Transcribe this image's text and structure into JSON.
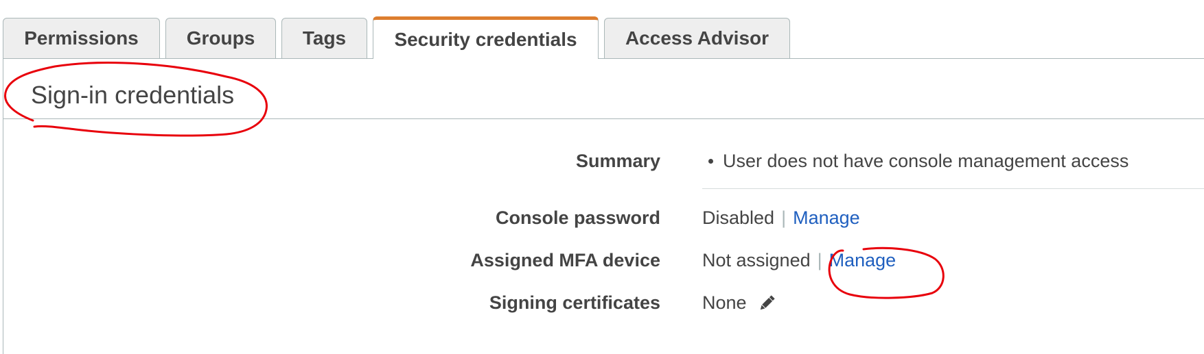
{
  "tabs": [
    {
      "label": "Permissions",
      "active": false
    },
    {
      "label": "Groups",
      "active": false
    },
    {
      "label": "Tags",
      "active": false
    },
    {
      "label": "Security credentials",
      "active": true
    },
    {
      "label": "Access Advisor",
      "active": false
    }
  ],
  "section": {
    "title": "Sign-in credentials"
  },
  "summary": {
    "label": "Summary",
    "items": [
      "User does not have console management access"
    ]
  },
  "console_password": {
    "label": "Console password",
    "value": "Disabled",
    "separator": "|",
    "link": "Manage"
  },
  "mfa": {
    "label": "Assigned MFA device",
    "value": "Not assigned",
    "separator": "|",
    "link": "Manage"
  },
  "signing_certificates": {
    "label": "Signing certificates",
    "value": "None",
    "icon": "pencil-icon"
  },
  "colors": {
    "active_tab_accent": "#dd7e2f",
    "link": "#1f5fbf",
    "annotation": "#e8000b"
  }
}
